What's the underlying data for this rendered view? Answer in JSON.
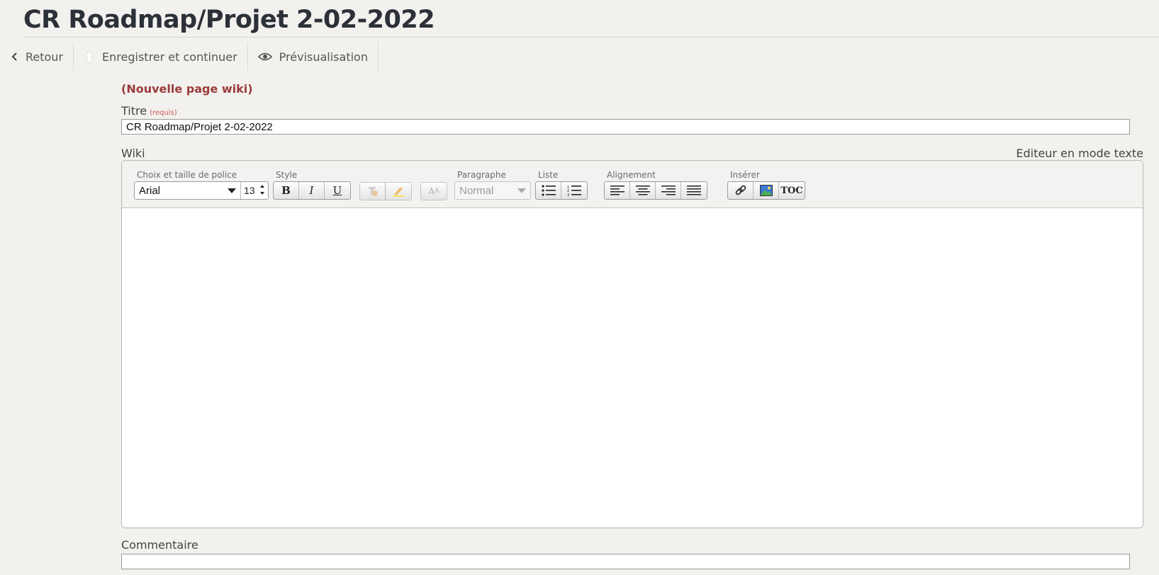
{
  "page": {
    "title": "CR Roadmap/Projet 2-02-2022"
  },
  "toolbar": {
    "back_label": "Retour",
    "save_label": "Enregistrer et continuer",
    "preview_label": "Prévisualisation"
  },
  "form": {
    "new_page_label": "(Nouvelle page wiki)",
    "title_label": "Titre",
    "required_label": "(requis)",
    "title_value": "CR Roadmap/Projet 2-02-2022",
    "wiki_label": "Wiki",
    "text_mode_link": "Editeur en mode texte",
    "comment_label": "Commentaire",
    "comment_value": ""
  },
  "editor": {
    "groups": {
      "font": "Choix et taille de police",
      "style": "Style",
      "paragraph": "Paragraphe",
      "list": "Liste",
      "alignment": "Alignement",
      "insert": "Insérer"
    },
    "font_value": "Arial",
    "size_value": "13",
    "paragraph_value": "Normal",
    "bold": "B",
    "italic": "I",
    "underline": "U",
    "toc": "TOC",
    "font_size_icon_text": "A"
  },
  "icons": {
    "back": "chevron-left-icon",
    "save": "upload-arrow-icon",
    "preview": "eye-icon"
  },
  "colors": {
    "background": "#f2f1ee",
    "title": "#2c3038",
    "new_page": "#9b3b3b",
    "required": "#d45555"
  }
}
